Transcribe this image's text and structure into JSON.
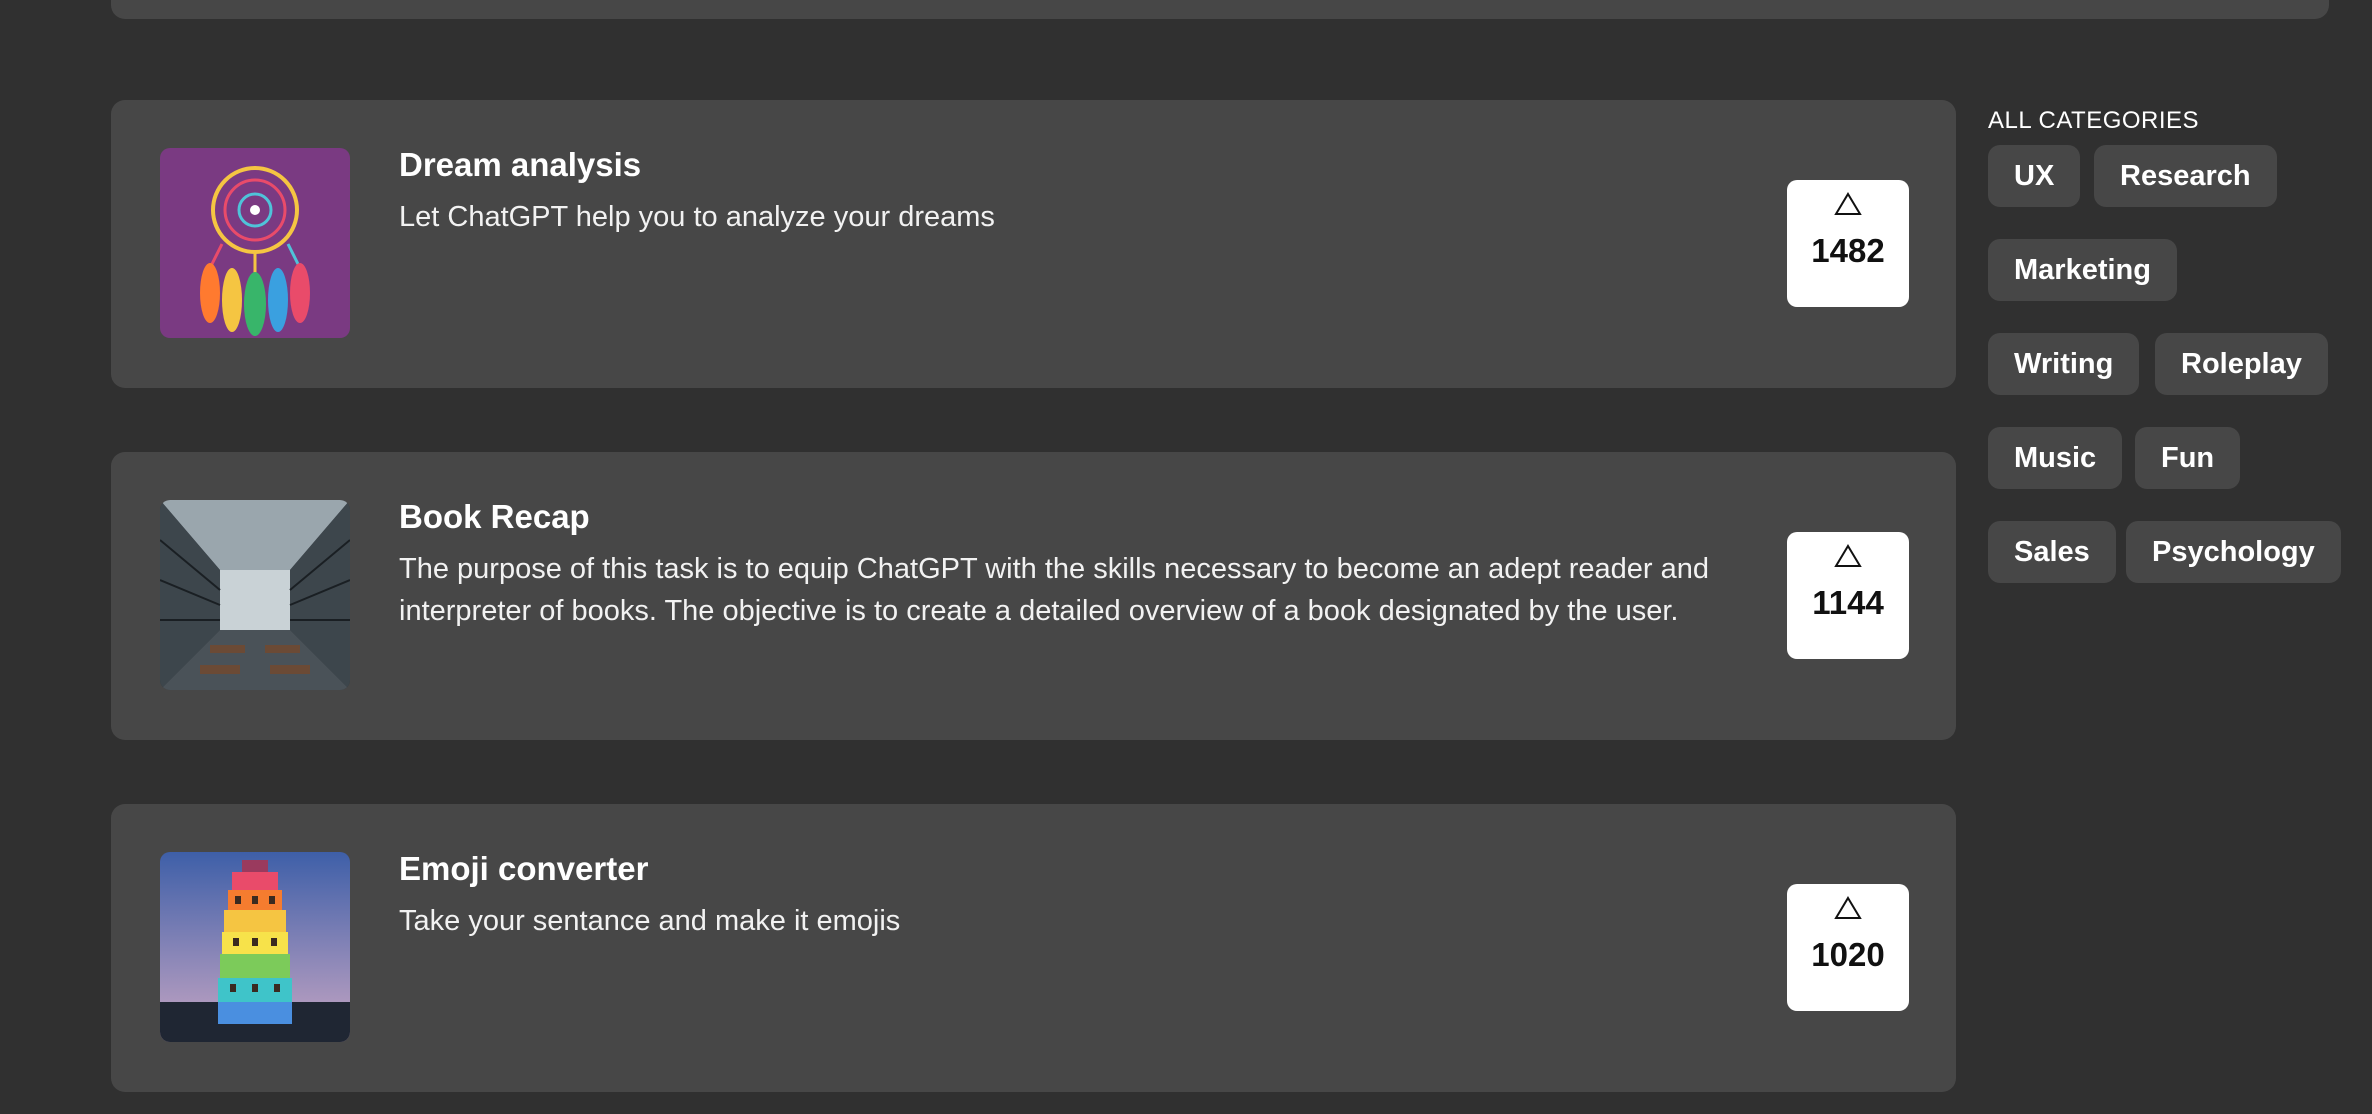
{
  "prompts": [
    {
      "title": "Dream analysis",
      "description": "Let ChatGPT help you to analyze your dreams",
      "upvotes": "1482",
      "image": "dreamcatcher-image"
    },
    {
      "title": "Book Recap",
      "description": "The purpose of this task is to equip ChatGPT with the skills necessary to become an adept reader and interpreter of books. The objective is to create a detailed overview of a book designated by the user.",
      "upvotes": "1144",
      "image": "library-hall-image"
    },
    {
      "title": "Emoji converter",
      "description": "Take your sentance and make it emojis",
      "upvotes": "1020",
      "image": "colorful-tower-image"
    }
  ],
  "categories": {
    "heading": "ALL CATEGORIES",
    "items": [
      "UX",
      "Research",
      "Marketing",
      "Writing",
      "Roleplay",
      "Music",
      "Fun",
      "Sales",
      "Psychology"
    ]
  },
  "icons": {
    "upvote": "triangle-up-icon"
  },
  "colors": {
    "page_background": "#303030",
    "card_background": "#474747",
    "vote_background": "#ffffff"
  }
}
